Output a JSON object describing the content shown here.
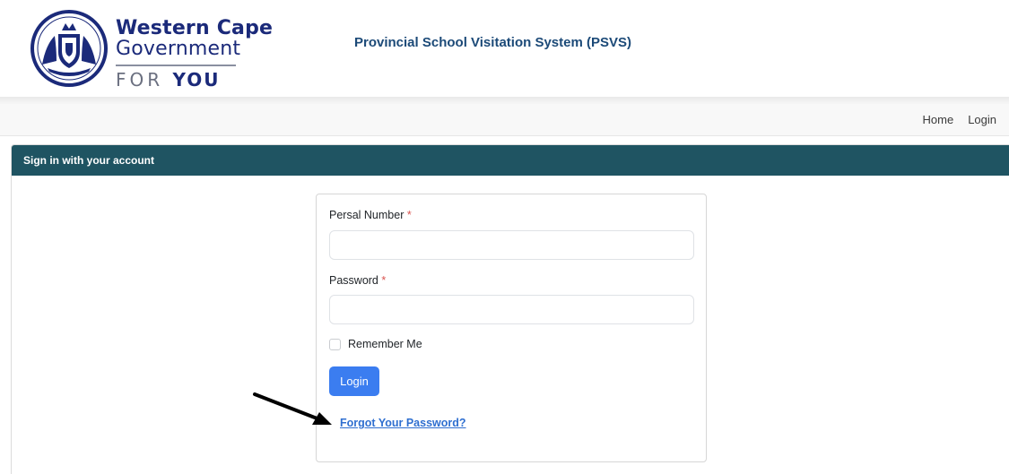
{
  "brand": {
    "line1": "Western Cape",
    "line2": "Government",
    "for_text": "FOR ",
    "you_text": "YOU",
    "colors": {
      "navy": "#1b2a7a",
      "grey": "#6b7080"
    }
  },
  "site_title": "Provincial School Visitation System (PSVS)",
  "nav": {
    "home": "Home",
    "login": "Login"
  },
  "card": {
    "header": "Sign in with your account",
    "header_color": "#1f5462"
  },
  "form": {
    "persal_label": "Persal Number",
    "password_label": "Password",
    "required_mark": "*",
    "persal_value": "",
    "password_value": "",
    "remember_label": "Remember Me",
    "remember_checked": false,
    "login_button": "Login",
    "forgot_link": "Forgot Your Password?",
    "button_color": "#3b7df0"
  },
  "annotation": {
    "icon": "arrow-icon"
  }
}
